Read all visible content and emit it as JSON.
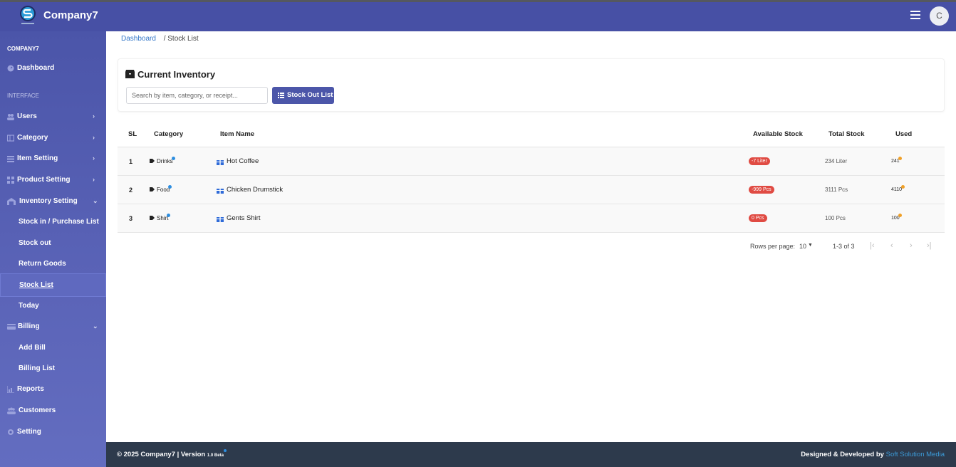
{
  "app": {
    "brand": "Company7",
    "avatar_initial": "C"
  },
  "breadcrumb": {
    "home": "Dashboard",
    "current": "/ Stock List"
  },
  "sidebar": {
    "company": "COMPANY7",
    "dashboard": "Dashboard",
    "section": "INTERFACE",
    "items": [
      {
        "label": "Users"
      },
      {
        "label": "Category"
      },
      {
        "label": "Item Setting"
      },
      {
        "label": "Product Setting"
      },
      {
        "label": "Inventory Setting"
      },
      {
        "label": "Stock in / Purchase List"
      },
      {
        "label": "Stock out"
      },
      {
        "label": "Return Goods"
      },
      {
        "label": "Stock List"
      },
      {
        "label": "Today"
      },
      {
        "label": "Billing"
      },
      {
        "label": "Add Bill"
      },
      {
        "label": "Billing List"
      },
      {
        "label": "Reports"
      },
      {
        "label": "Customers"
      },
      {
        "label": "Setting"
      }
    ]
  },
  "inventory": {
    "title": "Current Inventory",
    "search_placeholder": "Search by item, category, or receipt...",
    "stock_out_button": "Stock Out List"
  },
  "table": {
    "headers": {
      "sl": "SL",
      "category": "Category",
      "item": "Item Name",
      "available": "Available Stock",
      "total": "Total Stock",
      "used": "Used"
    },
    "rows": [
      {
        "sl": "1",
        "category": "Drinks",
        "item": "Hot Coffee",
        "available": "-7 Liter",
        "total": "234 Liter",
        "used": "241"
      },
      {
        "sl": "2",
        "category": "Food",
        "item": "Chicken Drumstick",
        "available": "-999 Pcs",
        "total": "3111 Pcs",
        "used": "4110"
      },
      {
        "sl": "3",
        "category": "Shirt",
        "item": "Gents Shirt",
        "available": "0 Pcs",
        "total": "100 Pcs",
        "used": "100"
      }
    ]
  },
  "pagination": {
    "rows_label": "Rows per page:",
    "rows_value": "10",
    "range": "1-3 of 3"
  },
  "footer": {
    "copyright": "© 2025 Company7 | Version",
    "version": "1.0 Beta",
    "designed_by": "Designed & Developed by",
    "developer": "Soft Solution Media"
  },
  "colors": {
    "primary": "#4750a5",
    "badge_danger": "#e04b43",
    "footer_bg": "#2d3a4c",
    "link": "#3477c8"
  }
}
